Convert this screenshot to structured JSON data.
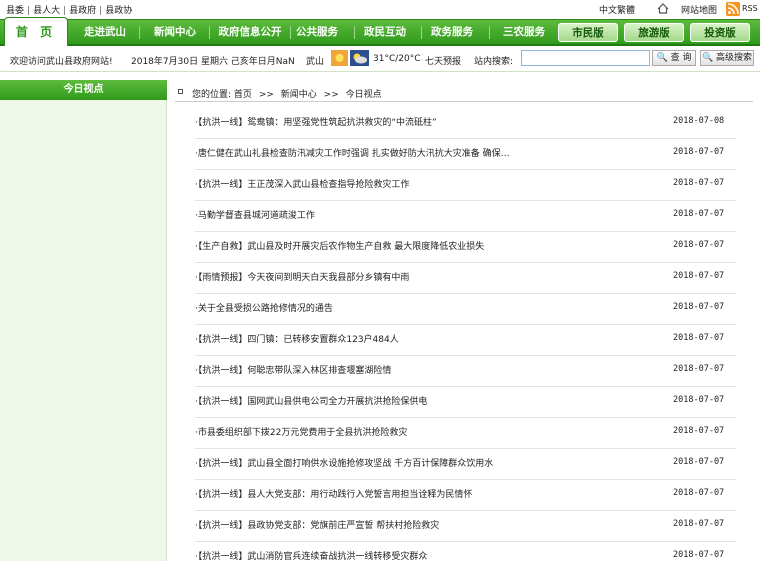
{
  "top_links": [
    "县委",
    "县人大",
    "县政府",
    "县政协"
  ],
  "lang_label": "中文繁體",
  "sitemap_label": "网站地图",
  "rss_label": "RSS",
  "nav": {
    "items": [
      "首 页",
      "走进武山",
      "新闻中心",
      "政府信息公开",
      "公共服务",
      "政民互动",
      "政务服务",
      "三农服务"
    ],
    "pills": [
      "市民版",
      "旅游版",
      "投资版"
    ]
  },
  "info": {
    "welcome": "欢迎访问武山县政府网站!",
    "date": "2018年7月30日 星期六 己亥年日月NaN",
    "city": "武山",
    "temp": "31°C/20°C",
    "forecast": "七天预报",
    "search_label": "站内搜索:",
    "search_value": "",
    "search_button": "🔍 查 询",
    "advanced_button": "🔍 高级搜索"
  },
  "sidebar": {
    "title": "今日视点"
  },
  "breadcrumb": {
    "prefix": "您的位置:",
    "items": [
      "首页",
      "新闻中心",
      "今日视点"
    ],
    "sep": ">>"
  },
  "news": [
    {
      "title": "·【抗洪一线】鸳鸯镇：用坚强党性筑起抗洪救灾的“中流砥柱”",
      "date": "2018-07-08"
    },
    {
      "title": "·唐仁健在武山礼县检查防汛减灾工作时强调 扎实做好防大汛抗大灾准备 确保…",
      "date": "2018-07-07"
    },
    {
      "title": "·【抗洪一线】王正茂深入武山县检查指导抢险救灾工作",
      "date": "2018-07-07"
    },
    {
      "title": "·马勤学督查县城河道疏浚工作",
      "date": "2018-07-07"
    },
    {
      "title": "·【生产自救】武山县及时开展灾后农作物生产自救 最大限度降低农业损失",
      "date": "2018-07-07"
    },
    {
      "title": "·【雨情预报】今天夜间到明天白天我县部分乡镇有中雨",
      "date": "2018-07-07"
    },
    {
      "title": "·关于全县受损公路抢修情况的通告",
      "date": "2018-07-07"
    },
    {
      "title": "·【抗洪一线】四门镇：已转移安置群众123户484人",
      "date": "2018-07-07"
    },
    {
      "title": "·【抗洪一线】何聪忠带队深入林区排查堰塞湖险情",
      "date": "2018-07-07"
    },
    {
      "title": "·【抗洪一线】国网武山县供电公司全力开展抗洪抢险保供电",
      "date": "2018-07-07"
    },
    {
      "title": "·市县委组织部下拨22万元党费用于全县抗洪抢险救灾",
      "date": "2018-07-07"
    },
    {
      "title": "·【抗洪一线】武山县全面打响供水设施抢修攻坚战 千方百计保障群众饮用水",
      "date": "2018-07-07"
    },
    {
      "title": "·【抗洪一线】县人大党支部：用行动践行入党誓言用担当诠释为民情怀",
      "date": "2018-07-07"
    },
    {
      "title": "·【抗洪一线】县政协党支部：党旗前庄严宣誓 帮扶村抢险救灾",
      "date": "2018-07-07"
    },
    {
      "title": "·【抗洪一线】武山消防官兵连续奋战抗洪一线转移受灾群众",
      "date": "2018-07-07"
    }
  ]
}
